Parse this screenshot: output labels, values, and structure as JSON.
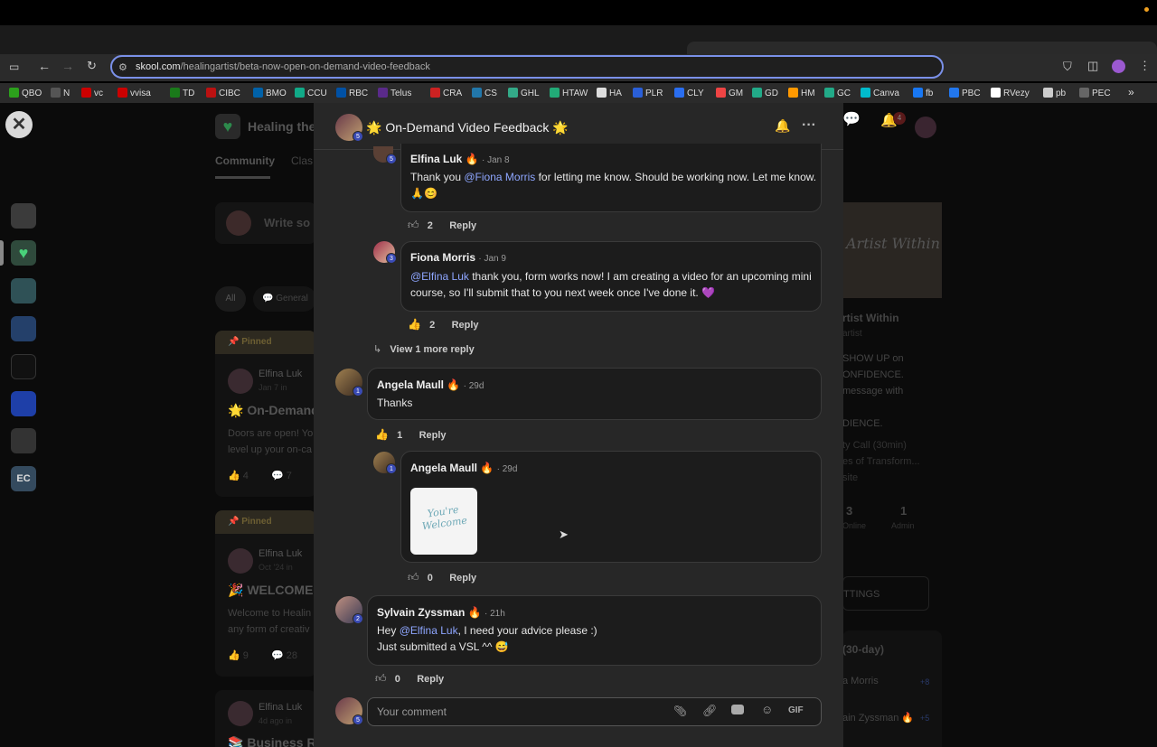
{
  "browser": {
    "url_host": "skool.com",
    "url_path": "/healingartist/beta-now-open-on-demand-video-feedback",
    "bookmarks": [
      "QBO",
      "N",
      "vc",
      "vvisa",
      "TD",
      "CIBC",
      "BMO",
      "CCU",
      "RBC",
      "Telus",
      "CRA",
      "CS",
      "GHL",
      "HTAW",
      "HA",
      "PLR",
      "CLY",
      "GM",
      "GD",
      "HM",
      "GC",
      "Canva",
      "fb",
      "PBC",
      "RVezy",
      "pb",
      "PEC"
    ],
    "bookmark_more": "»"
  },
  "background": {
    "group_name": "Healing the A",
    "tabs": [
      "Community",
      "Clas"
    ],
    "write_placeholder": "Write so",
    "filters": [
      "All",
      "General"
    ],
    "pinned_label": "Pinned",
    "posts": [
      {
        "author": "Elfina Luk",
        "meta": "Jan 7 in",
        "title": "On-Demand",
        "body1": "Doors are open! Yo",
        "body2": "level up your on-ca",
        "likes": "4",
        "comments": "7"
      },
      {
        "author": "Elfina Luk",
        "meta": "Oct '24 in",
        "title": "WELCOME!",
        "body1": "Welcome to Healin",
        "body2": "any form of creativ",
        "likes": "9",
        "comments": "28"
      },
      {
        "author": "Elfina Luk",
        "meta": "4d ago in",
        "title": "Business Re"
      }
    ],
    "side": {
      "title": "rtist Within",
      "subtitle": "artist",
      "l1": "SHOW UP on",
      "l2": "ONFIDENCE.",
      "l3": "message with",
      "l4": "DIENCE.",
      "l5": "ty Call (30min)",
      "l6": "es of Transform...",
      "l7": "site",
      "stat1": "3",
      "stat1_label": "Online",
      "stat2": "1",
      "stat2_label": "Admin",
      "settings": "TTINGS",
      "leader_title": "(30-day)",
      "leader1": "a Morris",
      "leader1_pts": "+8",
      "leader2": "ain Zyssman",
      "leader2_pts": "+5"
    },
    "notif_count": "4"
  },
  "modal": {
    "title": "On-Demand Video Feedback",
    "title_emoji": "🌟",
    "comments": [
      {
        "author": "Elfina Luk",
        "date": "Jan 8",
        "level": "5",
        "line1_pre": "Thank you ",
        "mention": "@Fiona Morris",
        "line1_post": " for letting me know. Should be working now. Let me know.",
        "line2": "🙏😊",
        "likes": "2",
        "reply": "Reply"
      },
      {
        "author": "Fiona Morris",
        "date": "Jan 9",
        "level": "3",
        "mention": "@Elfina Luk",
        "line1_post": " thank you, form works now! I am creating a video for an upcoming mini",
        "line2": "course, so I'll submit that to you next week once I've done it. 💜",
        "likes": "2",
        "reply": "Reply"
      },
      {
        "author": "Angela Maull",
        "date": "29d",
        "level": "1",
        "line1": "Thanks",
        "likes": "1",
        "reply": "Reply"
      },
      {
        "author": "Angela Maull",
        "date": "29d",
        "level": "1",
        "sticker": "You're Welcome",
        "likes": "0",
        "reply": "Reply"
      },
      {
        "author": "Sylvain Zyssman",
        "date": "21h",
        "level": "2",
        "line1_pre": "Hey ",
        "mention": "@Elfina Luk",
        "line1_post": ", I need your advice please :)",
        "line2": "Just submitted a VSL ^^ 😅",
        "likes": "0",
        "reply": "Reply"
      }
    ],
    "view_more": "View 1 more reply",
    "composer_placeholder": "Your comment",
    "composer_level": "5",
    "gif_label": "GIF",
    "header_level": "5"
  },
  "colors": {
    "mention": "#8ea6ff",
    "level_badge": "#3a4bb5",
    "url_focus": "#7a90e8"
  }
}
